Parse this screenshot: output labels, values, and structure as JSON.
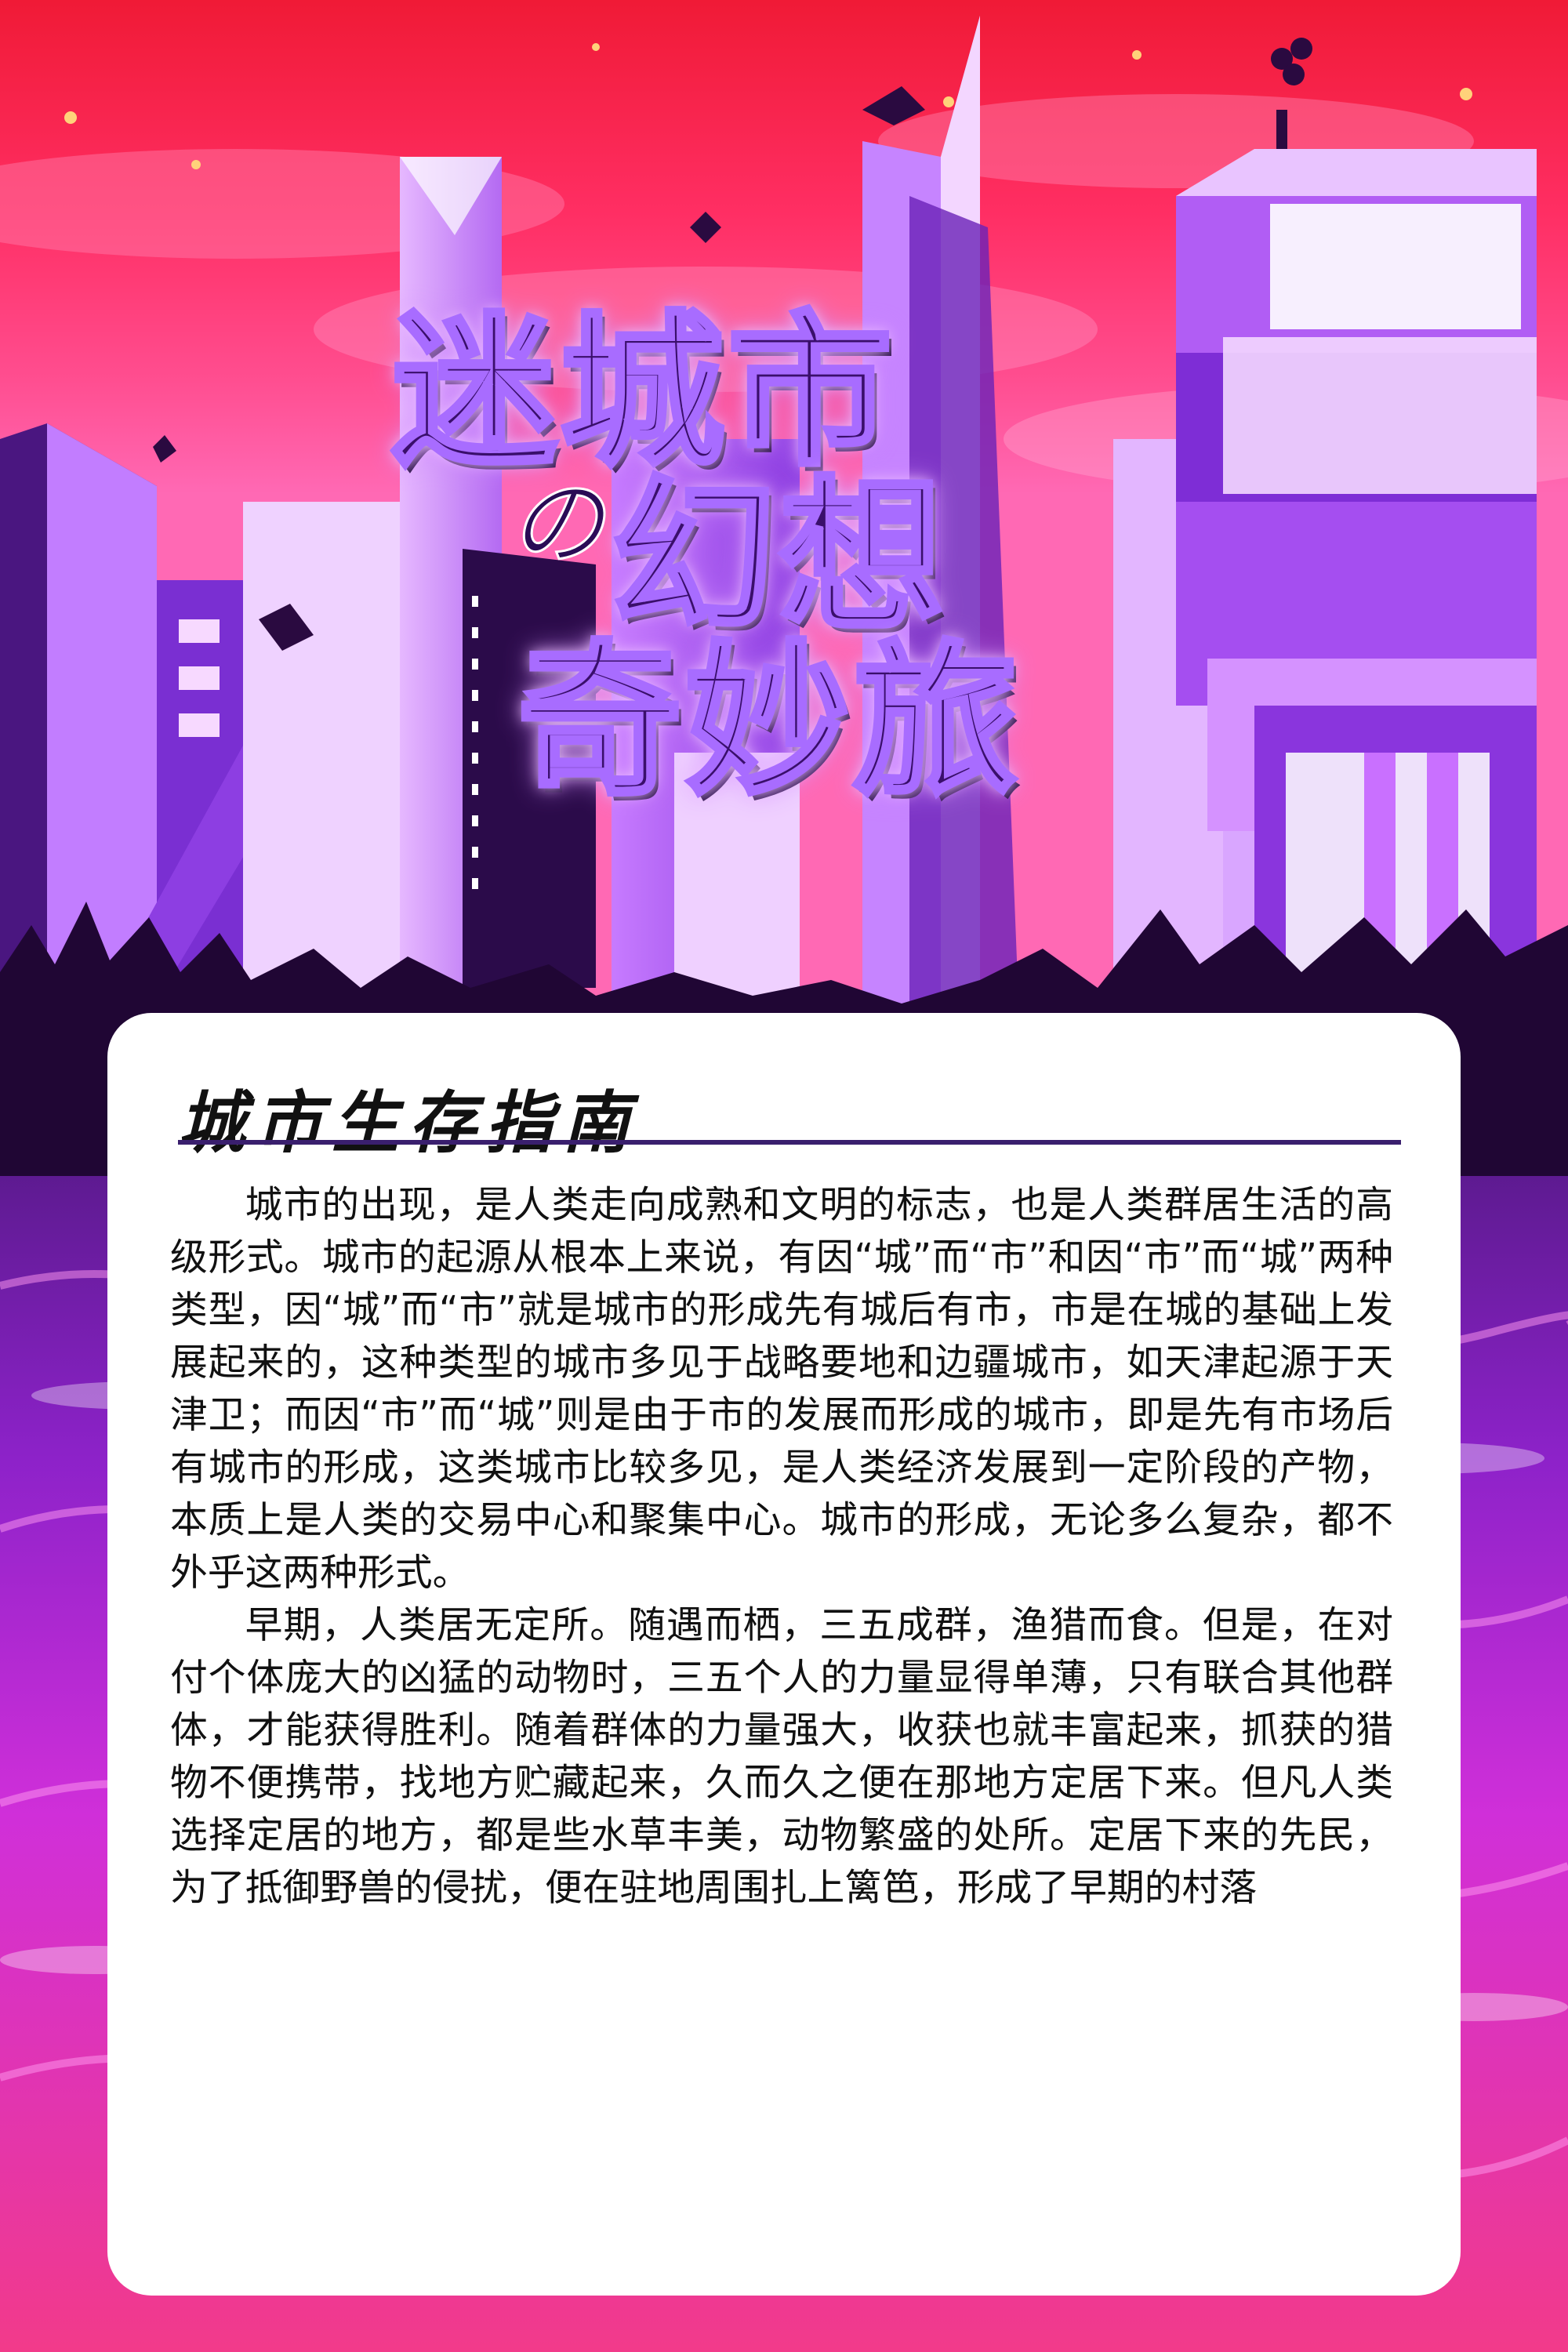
{
  "title": {
    "line1": "迷城市",
    "connector": "の",
    "line2": "幻想",
    "line3": "奇妙旅"
  },
  "card": {
    "heading": "城市生存指南",
    "paragraphs": [
      "城市的出现，是人类走向成熟和文明的标志，也是人类群居生活的高级形式。城市的起源从根本上来说，有因“城”而“市”和因“市”而“城”两种类型，因“城”而“市”就是城市的形成先有城后有市，市是在城的基础上发展起来的，这种类型的城市多见于战略要地和边疆城市，如天津起源于天津卫；而因“市”而“城”则是由于市的发展而形成的城市，即是先有市场后有城市的形成，这类城市比较多见，是人类经济发展到一定阶段的产物，本质上是人类的交易中心和聚集中心。城市的形成，无论多么复杂，都不外乎这两种形式。",
      "早期，人类居无定所。随遇而栖，三五成群，渔猎而食。但是，在对付个体庞大的凶猛的动物时，三五个人的力量显得单薄，只有联合其他群体，才能获得胜利。随着群体的力量强大，收获也就丰富起来，抓获的猎物不便携带，找地方贮藏起来，久而久之便在那地方定居下来。但凡人类选择定居的地方，都是些水草丰美，动物繁盛的处所。定居下来的先民，为了抵御野兽的侵扰，便在驻地周围扎上篱笆，形成了早期的村落"
    ]
  },
  "colors": {
    "sky_top": "#f41f3a",
    "sky_mid": "#ff3f7e",
    "building_purple": "#7b2fd0",
    "building_light": "#d8a4ff",
    "building_dark": "#2b0b4a",
    "water": "#b21ad0",
    "card_bg": "#ffffff",
    "rule": "#3a1f6e"
  }
}
